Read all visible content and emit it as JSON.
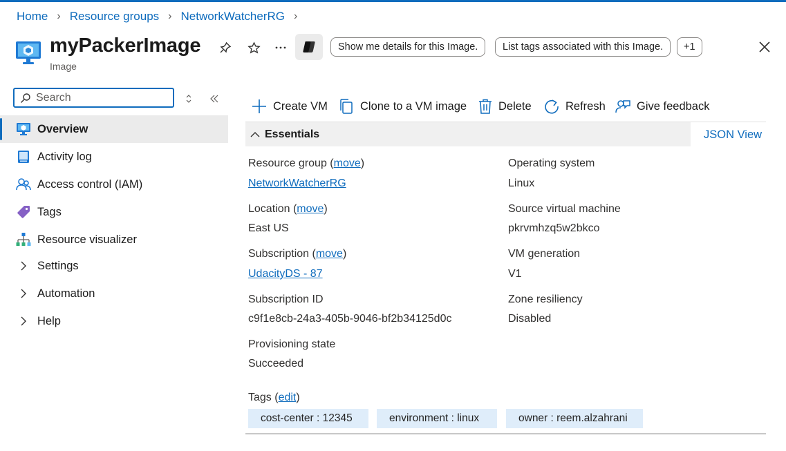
{
  "breadcrumb": [
    "Home",
    "Resource groups",
    "NetworkWatcherRG"
  ],
  "header": {
    "title": "myPackerImage",
    "subtitle": "Image",
    "suggestions": [
      "Show me details for this Image.",
      "List tags associated with this Image.",
      "+1"
    ]
  },
  "sidebar": {
    "search_placeholder": "Search",
    "items": [
      {
        "label": "Overview",
        "icon": "overview-icon",
        "active": true
      },
      {
        "label": "Activity log",
        "icon": "activity-log-icon"
      },
      {
        "label": "Access control (IAM)",
        "icon": "access-control-icon"
      },
      {
        "label": "Tags",
        "icon": "tag-icon"
      },
      {
        "label": "Resource visualizer",
        "icon": "resource-visualizer-icon"
      },
      {
        "label": "Settings",
        "icon": "chevron-right-icon"
      },
      {
        "label": "Automation",
        "icon": "chevron-right-icon"
      },
      {
        "label": "Help",
        "icon": "chevron-right-icon"
      }
    ]
  },
  "toolbar": {
    "create_vm": "Create VM",
    "clone": "Clone to a VM image",
    "delete": "Delete",
    "refresh": "Refresh",
    "feedback": "Give feedback"
  },
  "essentials": {
    "title": "Essentials",
    "json_view": "JSON View",
    "move": "move",
    "resource_group_label": "Resource group",
    "resource_group_value": "NetworkWatcherRG",
    "location_label": "Location",
    "location_value": "East US",
    "subscription_label": "Subscription",
    "subscription_value": "UdacityDS - 87",
    "subscription_id_label": "Subscription ID",
    "subscription_id_value": "c9f1e8cb-24a3-405b-9046-bf2b34125d0c",
    "provisioning_label": "Provisioning state",
    "provisioning_value": "Succeeded",
    "os_label": "Operating system",
    "os_value": "Linux",
    "source_vm_label": "Source virtual machine",
    "source_vm_value": "pkrvmhzq5w2bkco",
    "vm_gen_label": "VM generation",
    "vm_gen_value": "V1",
    "zone_label": "Zone resiliency",
    "zone_value": "Disabled",
    "tags_label": "Tags",
    "tags_edit": "edit",
    "tags": [
      "cost-center : 12345",
      "environment : linux",
      "owner : reem.alzahrani"
    ]
  },
  "colors": {
    "accent": "#0f6cbd",
    "active_bg": "#ebebeb",
    "tag_bg": "#dfedfa"
  }
}
